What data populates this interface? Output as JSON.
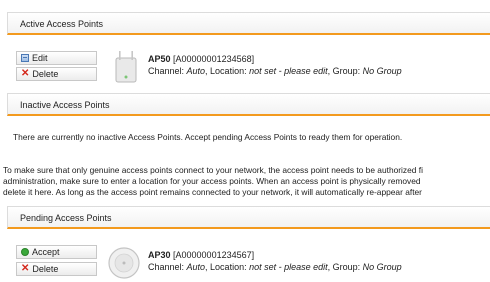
{
  "active": {
    "title": "Active Access Points",
    "edit_label": "Edit",
    "delete_label": "Delete",
    "ap_name": "AP50",
    "ap_id": "[A00000001234568]",
    "channel_label": "Channel: ",
    "channel_value": "Auto",
    "location_label": ", Location: ",
    "location_value": "not set - please edit",
    "group_label": ", Group: ",
    "group_value": "No Group"
  },
  "inactive": {
    "title": "Inactive Access Points",
    "message": "There are currently no inactive Access Points. Accept pending Access Points to ready them for operation."
  },
  "info": {
    "line1": "To make sure that only genuine access points connect to your network, the access point needs to be authorized fi",
    "line2": "administration, make sure to enter a location for your access points. When an access point is physically removed",
    "line3": "delete it here. As long as the access point remains connected to your network, it will automatically re-appear after"
  },
  "pending": {
    "title": "Pending Access Points",
    "accept_label": "Accept",
    "delete_label": "Delete",
    "ap_name": "AP30",
    "ap_id": "[A00000001234567]",
    "channel_label": "Channel: ",
    "channel_value": "Auto",
    "location_label": ", Location: ",
    "location_value": "not set - please edit",
    "group_label": ", Group: ",
    "group_value": "No Group"
  },
  "colors": {
    "accent": "#f39a1e",
    "delete_icon": "#d3271b",
    "accept_icon": "#3aa83a"
  }
}
